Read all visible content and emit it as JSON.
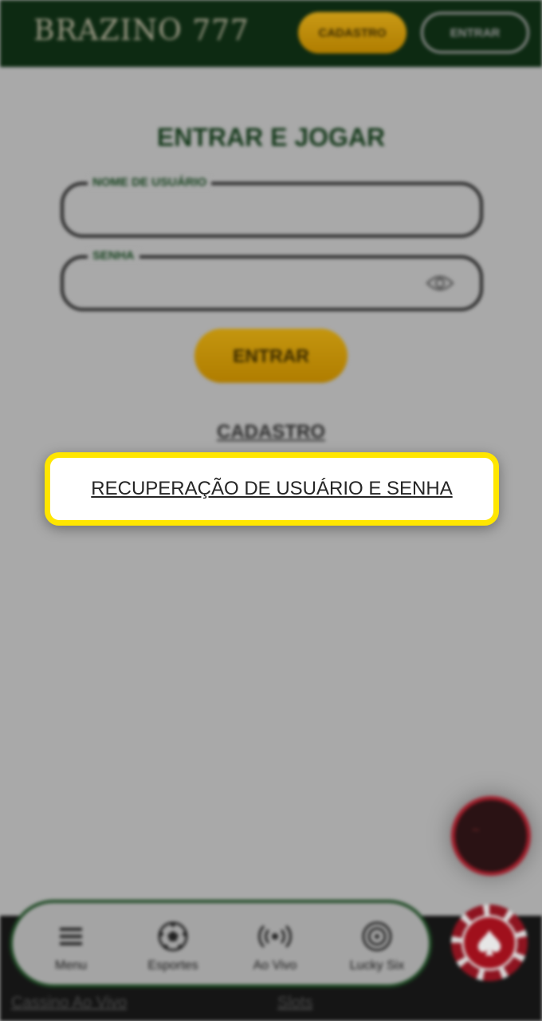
{
  "header": {
    "logo": "BRAZINO 777",
    "signup_label": "CADASTRO",
    "login_label": "ENTRAR"
  },
  "form": {
    "title": "ENTRAR E JOGAR",
    "username_label": "NOME DE USUÁRIO",
    "username_value": "",
    "password_label": "SENHA",
    "password_value": "",
    "submit_label": "ENTRAR",
    "signup_link": "CADASTRO",
    "recover_link": "RECUPERAÇÃO DE USUÁRIO E SENHA"
  },
  "nav": {
    "items": [
      {
        "label": "Menu",
        "icon": "menu-icon"
      },
      {
        "label": "Esportes",
        "icon": "soccer-ball-icon"
      },
      {
        "label": "Ao Vivo",
        "icon": "live-broadcast-icon"
      },
      {
        "label": "Lucky Six",
        "icon": "lucky-six-icon"
      }
    ]
  },
  "sub_links": [
    "Cassino Ao Vivo",
    "Slots"
  ],
  "colors": {
    "header_bg": "#0d2a12",
    "accent_gold": "#c4960f",
    "highlight": "#ffe600",
    "chip_red": "#a0101c"
  }
}
